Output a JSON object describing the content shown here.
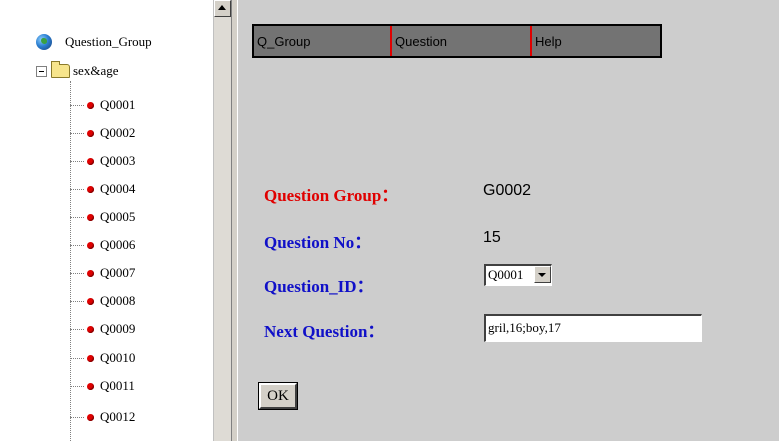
{
  "tree": {
    "root_label": "Question_Group",
    "folder_label": "sex&age",
    "items": [
      "Q0001",
      "Q0002",
      "Q0003",
      "Q0004",
      "Q0005",
      "Q0006",
      "Q0007",
      "Q0008",
      "Q0009",
      "Q0010",
      "Q0011",
      "Q0012"
    ]
  },
  "menu": {
    "items": [
      "Q_Group",
      "Question",
      "Help"
    ]
  },
  "form": {
    "group_label": "Question Group：",
    "group_value": "G0002",
    "no_label": "Question No：",
    "no_value": "15",
    "id_label": "Question_ID：",
    "id_value": "Q0001",
    "next_label": "Next Question：",
    "next_value": "gril,16;boy,17",
    "ok_label": "OK"
  },
  "colors": {
    "menu_bg": "#737373",
    "menu_separator": "#e00000",
    "label_red": "#e00000",
    "label_blue": "#1010c8",
    "tree_bullet": "#e00000"
  }
}
